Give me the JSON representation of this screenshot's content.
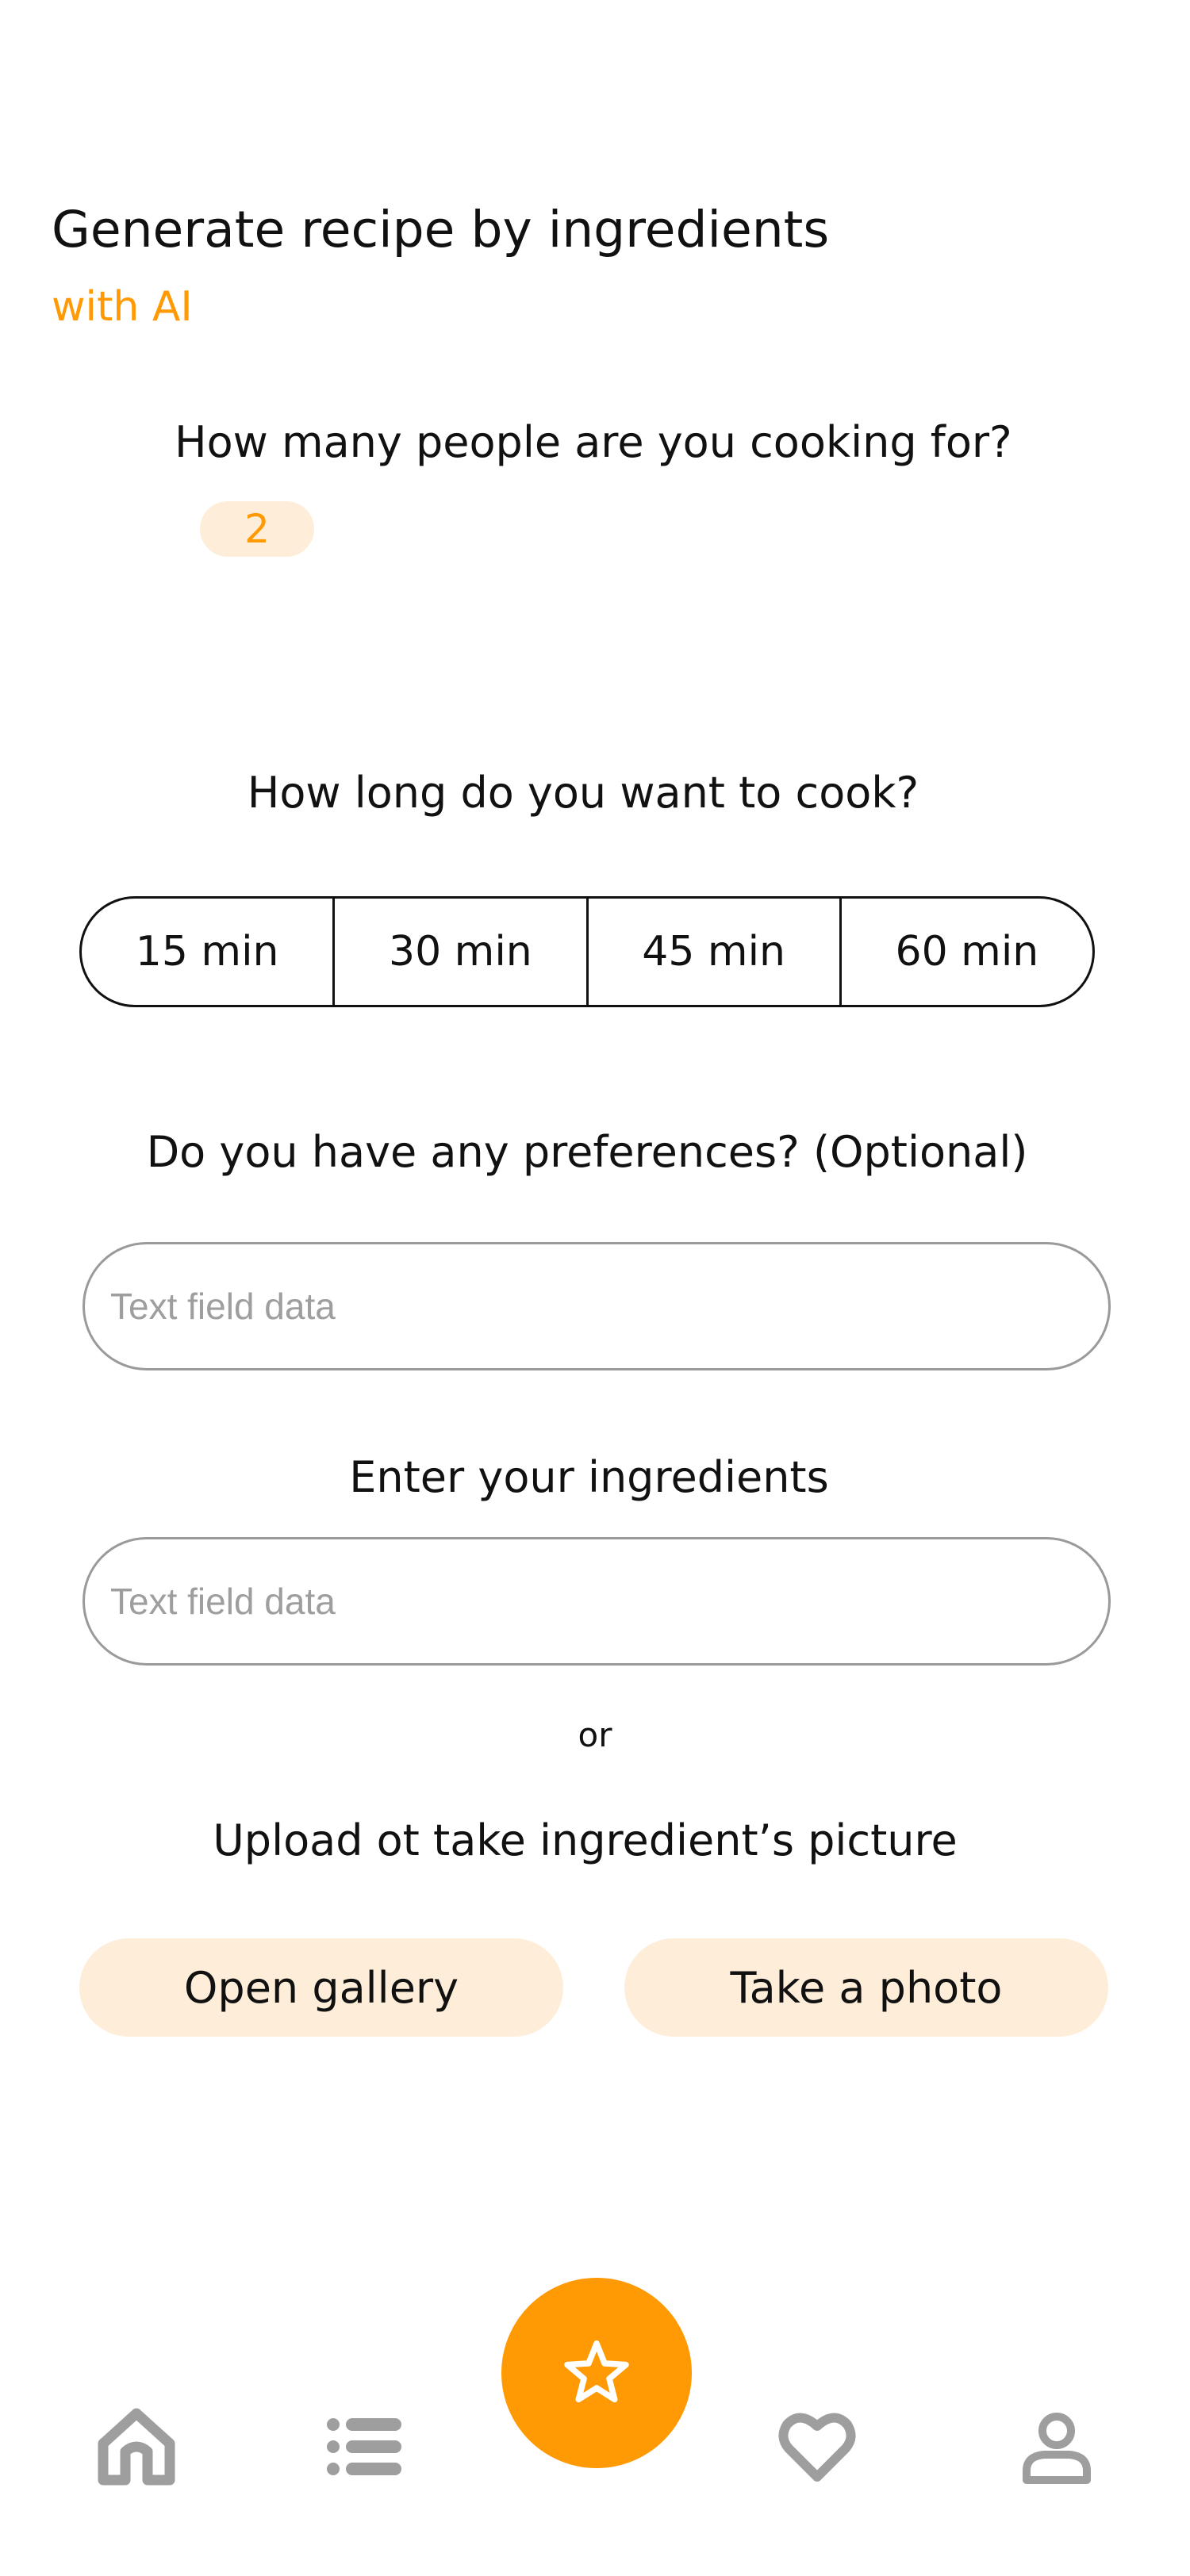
{
  "header": {
    "title": "Generate recipe by ingredients",
    "subtitle": "with AI"
  },
  "people": {
    "question": "How many people are you cooking for?",
    "count": "2"
  },
  "time": {
    "question": "How long do you want to cook?",
    "options": [
      "15 min",
      "30 min",
      "45 min",
      "60 min"
    ]
  },
  "preferences": {
    "question": "Do you have any preferences? (Optional)",
    "placeholder": "Text field data"
  },
  "ingredients": {
    "question": "Enter your ingredients",
    "placeholder": "Text field data"
  },
  "separator": "or",
  "upload": {
    "question": "Upload ot take ingredient’s picture",
    "gallery_label": "Open gallery",
    "photo_label": "Take a photo"
  },
  "bottom_nav": {
    "items": [
      "home-icon",
      "list-icon",
      "star-icon",
      "heart-icon",
      "profile-icon"
    ]
  },
  "colors": {
    "accent": "#FF9A05",
    "accent_light": "#FEEED9",
    "icon_gray": "#9E9E9E"
  }
}
